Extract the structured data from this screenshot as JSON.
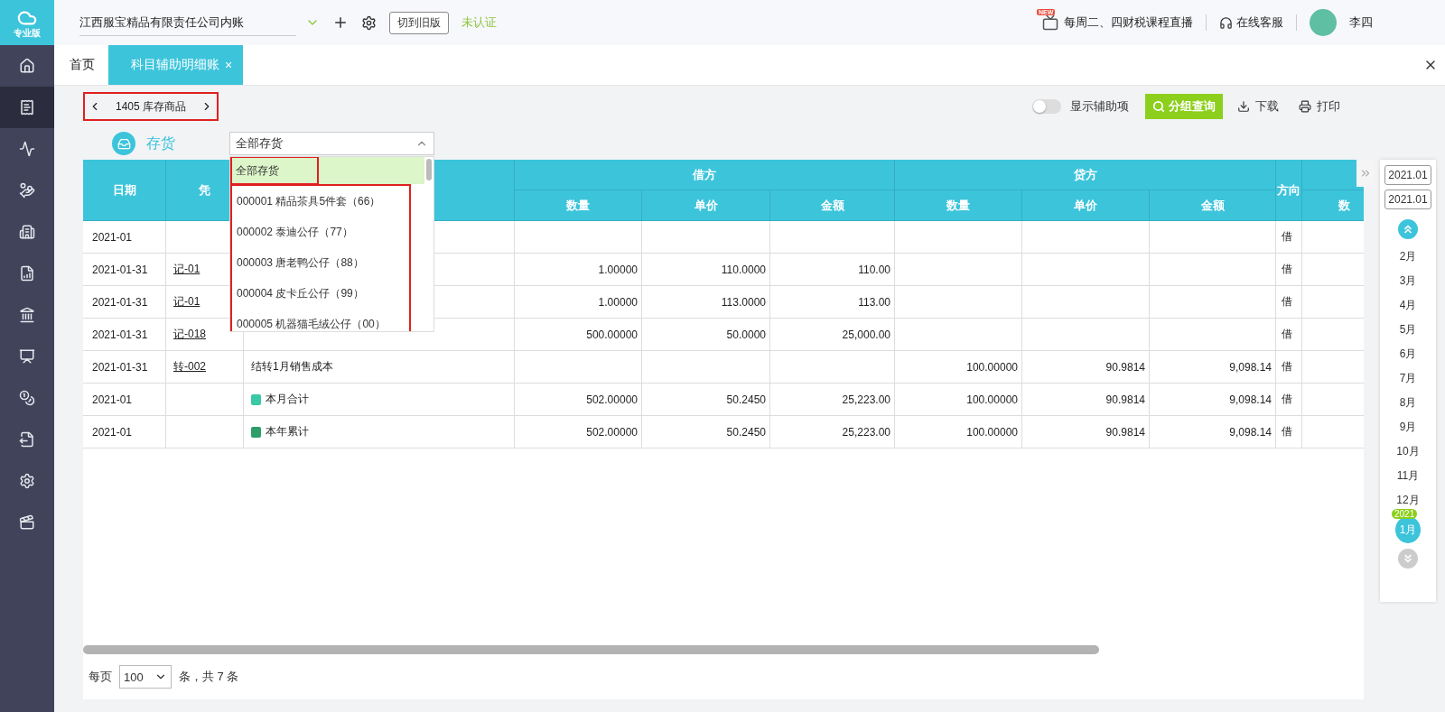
{
  "brand": {
    "label": "专业版"
  },
  "sidebar": {
    "items": [
      {
        "kind": "home",
        "selected": false
      },
      {
        "kind": "ledger",
        "selected": true
      },
      {
        "kind": "chart",
        "selected": false
      },
      {
        "kind": "moneybag",
        "selected": false
      },
      {
        "kind": "building",
        "selected": false
      },
      {
        "kind": "report",
        "selected": false
      },
      {
        "kind": "cashier",
        "selected": false
      },
      {
        "kind": "board",
        "selected": false
      },
      {
        "kind": "coins",
        "selected": false
      },
      {
        "kind": "transfer",
        "selected": false
      },
      {
        "kind": "settings",
        "selected": false
      },
      {
        "kind": "video",
        "selected": false
      }
    ]
  },
  "topbar": {
    "company": "江西服宝精品有限责任公司内账",
    "switch_button": "切到旧版",
    "status": "未认证",
    "promo": {
      "badge": "NEW",
      "label": "每周二、四财税课程直播"
    },
    "support": "在线客服",
    "user": "李四"
  },
  "tabs": [
    {
      "label": "首页",
      "selected": false
    },
    {
      "label": "科目辅助明细账",
      "selected": true,
      "close": "×"
    }
  ],
  "account": {
    "label": "1405  库存商品"
  },
  "toolbar": {
    "toggle": {
      "label": "显示辅助项",
      "on": false
    },
    "group_query": "分组查询",
    "download": "下载",
    "print": "打印"
  },
  "filter": {
    "label": "存货",
    "value": "全部存货",
    "expanded": true,
    "options": [
      {
        "label": "全部存货",
        "selected": true
      },
      {
        "label": "000001 精品茶具5件套（66）",
        "selected": false
      },
      {
        "label": "000002 泰迪公仔（77）",
        "selected": false
      },
      {
        "label": "000003 唐老鸭公仔（88）",
        "selected": false
      },
      {
        "label": "000004 皮卡丘公仔（99）",
        "selected": false
      },
      {
        "label": "000005 机器猫毛绒公仔（00）",
        "selected": false
      }
    ]
  },
  "table": {
    "columns": {
      "date": "日期",
      "voucher": "凭",
      "debit": {
        "label": "借方",
        "sub": [
          "数量",
          "单价",
          "金额"
        ]
      },
      "credit": {
        "label": "贷方",
        "sub": [
          "数量",
          "单价",
          "金额"
        ]
      },
      "direction": "方向",
      "column_11": "数"
    },
    "rows": [
      {
        "kind": "entry",
        "date": "2021-01",
        "direction": "借"
      },
      {
        "kind": "entry",
        "date": "2021-01-31",
        "voucher": "记-01",
        "d_qty": "1.00000",
        "d_price": "110.0000",
        "d_amount": "110.00",
        "direction": "借"
      },
      {
        "kind": "entry",
        "date": "2021-01-31",
        "voucher": "记-01",
        "d_qty": "1.00000",
        "d_price": "113.0000",
        "d_amount": "113.00",
        "direction": "借"
      },
      {
        "kind": "entry",
        "date": "2021-01-31",
        "voucher": "记-018",
        "d_qty": "500.00000",
        "d_price": "50.0000",
        "d_amount": "25,000.00",
        "direction": "借"
      },
      {
        "kind": "entry",
        "date": "2021-01-31",
        "voucher": "转-002",
        "summary": "结转1月销售成本",
        "c_qty": "100.00000",
        "c_price": "90.9814",
        "c_amount": "9,098.14",
        "direction": "借"
      },
      {
        "kind": "month",
        "date": "2021-01",
        "summary": "本月合计",
        "d_qty": "502.00000",
        "d_price": "50.2450",
        "d_amount": "25,223.00",
        "c_qty": "100.00000",
        "c_price": "90.9814",
        "c_amount": "9,098.14",
        "direction": "借"
      },
      {
        "kind": "year",
        "date": "2021-01",
        "summary": "本年累计",
        "d_qty": "502.00000",
        "d_price": "50.2450",
        "d_amount": "25,223.00",
        "c_qty": "100.00000",
        "c_price": "90.9814",
        "c_amount": "9,098.14",
        "direction": "借"
      }
    ]
  },
  "pagination": {
    "label": "每页",
    "page_size": "100",
    "summary": "条，共 7 条"
  },
  "period_panel": {
    "from": "2021.01",
    "to": "2021.01",
    "months": [
      {
        "label": "2月",
        "selected": false
      },
      {
        "label": "3月",
        "selected": false
      },
      {
        "label": "4月",
        "selected": false
      },
      {
        "label": "5月",
        "selected": false
      },
      {
        "label": "6月",
        "selected": false
      },
      {
        "label": "7月",
        "selected": false
      },
      {
        "label": "8月",
        "selected": false
      },
      {
        "label": "9月",
        "selected": false
      },
      {
        "label": "10月",
        "selected": false
      },
      {
        "label": "11月",
        "selected": false
      },
      {
        "label": "12月",
        "selected": false
      },
      {
        "label": "1月",
        "selected": true,
        "badge": "2021"
      }
    ]
  }
}
